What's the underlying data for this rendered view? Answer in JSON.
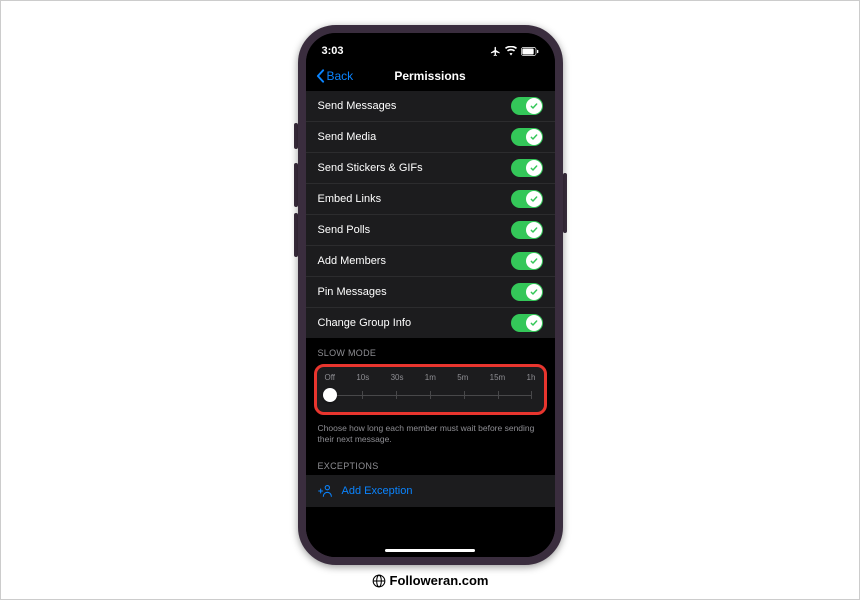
{
  "statusBar": {
    "time": "3:03"
  },
  "nav": {
    "back": "Back",
    "title": "Permissions"
  },
  "permissions": [
    {
      "label": "Send Messages",
      "on": true
    },
    {
      "label": "Send Media",
      "on": true
    },
    {
      "label": "Send Stickers & GIFs",
      "on": true
    },
    {
      "label": "Embed Links",
      "on": true
    },
    {
      "label": "Send Polls",
      "on": true
    },
    {
      "label": "Add Members",
      "on": true
    },
    {
      "label": "Pin Messages",
      "on": true
    },
    {
      "label": "Change Group Info",
      "on": true
    }
  ],
  "slowMode": {
    "header": "SLOW MODE",
    "labels": [
      "Off",
      "10s",
      "30s",
      "1m",
      "5m",
      "15m",
      "1h"
    ],
    "help": "Choose how long each member must wait before sending their next message."
  },
  "exceptions": {
    "header": "EXCEPTIONS",
    "add": "Add Exception"
  },
  "brand": "Followeran.com"
}
